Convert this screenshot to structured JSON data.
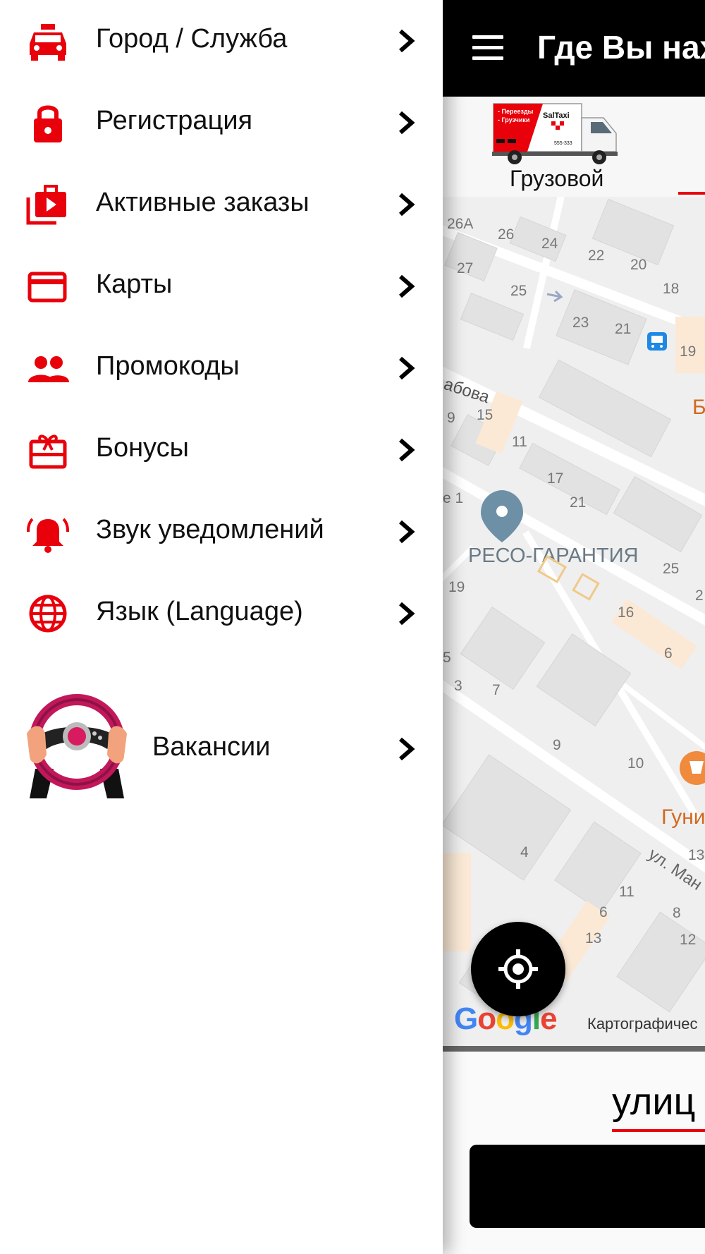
{
  "drawer": {
    "items": [
      {
        "label": "Город / Служба",
        "icon": "taxi-car-icon"
      },
      {
        "label": "Регистрация",
        "icon": "lock-icon"
      },
      {
        "label": "Активные заказы",
        "icon": "play-queue-icon"
      },
      {
        "label": "Карты",
        "icon": "credit-card-icon"
      },
      {
        "label": "Промокоды",
        "icon": "people-icon"
      },
      {
        "label": "Бонусы",
        "icon": "gift-card-icon"
      },
      {
        "label": "Звук уведомлений",
        "icon": "bell-ring-icon"
      },
      {
        "label": "Язык (Language)",
        "icon": "globe-icon"
      }
    ],
    "vacancies": {
      "label": "Вакансии",
      "icon": "steering-wheel-icon"
    }
  },
  "app": {
    "title": "Где Вы нах",
    "service": {
      "label": "Грузовой",
      "truck_banner_lines": [
        "- Переезды",
        "- Грузчики"
      ],
      "truck_brand": "SalTaxi",
      "truck_phone": "555-333"
    },
    "map": {
      "poi": "РЕСО-ГАРАНТИЯ",
      "partial_labels": [
        "Б",
        "Гуни",
        "ул. Ман",
        "абова"
      ],
      "house_numbers": [
        "26A",
        "26",
        "24",
        "22",
        "20",
        "27",
        "25",
        "18",
        "23",
        "21",
        "19",
        "9",
        "15",
        "11",
        "17",
        "21",
        "е 1",
        "25",
        "19",
        "16",
        "6",
        "5",
        "3",
        "7",
        "9",
        "10",
        "13",
        "4",
        "11",
        "6",
        "8",
        "13",
        "12",
        "2"
      ],
      "logo": "Google",
      "copyright": "Картографичес"
    },
    "address_text": "улиц"
  },
  "colors": {
    "accent": "#e8000b",
    "topbar": "#000000"
  }
}
